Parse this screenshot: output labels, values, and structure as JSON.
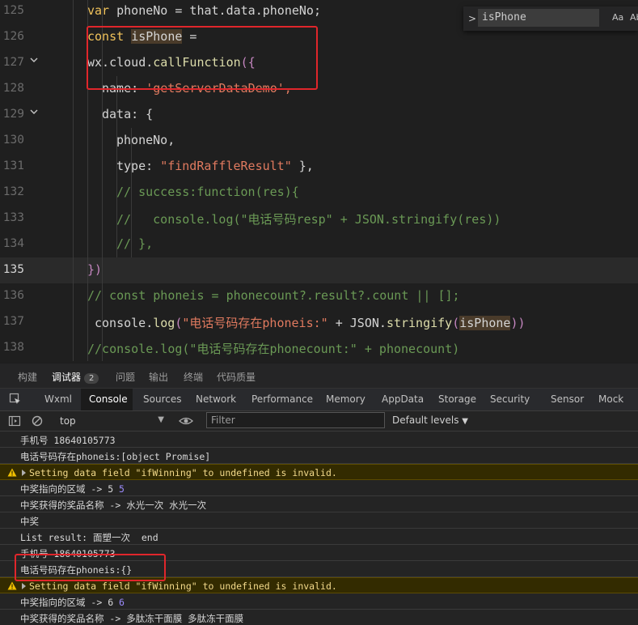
{
  "editor": {
    "lines": [
      {
        "no": "125",
        "segs": [
          {
            "t": "var ",
            "c": "kw"
          },
          {
            "t": "phoneNo = that.data.phoneNo;",
            "c": "var"
          }
        ]
      },
      {
        "no": "126",
        "segs": [
          {
            "t": "const ",
            "c": "kw"
          },
          {
            "t": "isPhone",
            "c": "var hl"
          },
          {
            "t": " =",
            "c": "var"
          }
        ]
      },
      {
        "no": "127",
        "segs": [
          {
            "t": "wx.cloud.",
            "c": "var"
          },
          {
            "t": "callFunction",
            "c": "fn"
          },
          {
            "t": "(",
            "c": "bracket"
          },
          {
            "t": "{",
            "c": "bracket"
          }
        ]
      },
      {
        "no": "128",
        "segs": [
          {
            "t": "name: ",
            "c": "prop"
          },
          {
            "t": "'getServerDataDemo',",
            "c": "str2"
          }
        ]
      },
      {
        "no": "129",
        "segs": [
          {
            "t": "data: {",
            "c": "prop"
          }
        ]
      },
      {
        "no": "130",
        "segs": [
          {
            "t": "phoneNo,",
            "c": "var"
          }
        ]
      },
      {
        "no": "131",
        "segs": [
          {
            "t": "type: ",
            "c": "prop"
          },
          {
            "t": "\"findRaffleResult\"",
            "c": "str2"
          },
          {
            "t": " },",
            "c": "var"
          }
        ]
      },
      {
        "no": "132",
        "segs": [
          {
            "t": "// success:function(res){",
            "c": "cm"
          }
        ]
      },
      {
        "no": "133",
        "segs": [
          {
            "t": "//   console.log(\"电话号码resp\" + JSON.stringify(res))",
            "c": "cm"
          }
        ]
      },
      {
        "no": "134",
        "segs": [
          {
            "t": "// },",
            "c": "cm"
          }
        ]
      },
      {
        "no": "135",
        "segs": [
          {
            "t": "}",
            "c": "bracket"
          },
          {
            "t": ")",
            "c": "bracket"
          }
        ]
      },
      {
        "no": "136",
        "segs": [
          {
            "t": "// const phoneis = phonecount?.result?.count || [];",
            "c": "cm"
          }
        ]
      },
      {
        "no": "137",
        "segs": [
          {
            "t": "console.",
            "c": "var"
          },
          {
            "t": "log",
            "c": "fn"
          },
          {
            "t": "(",
            "c": "bracket"
          },
          {
            "t": "\"电话号码存在phoneis:\"",
            "c": "str2"
          },
          {
            "t": " + JSON.",
            "c": "var"
          },
          {
            "t": "stringify",
            "c": "fn"
          },
          {
            "t": "(",
            "c": "bracket"
          },
          {
            "t": "isPhone",
            "c": "var hl"
          },
          {
            "t": "))",
            "c": "bracket"
          }
        ]
      },
      {
        "no": "138",
        "segs": [
          {
            "t": "//console.log(\"电话号码存在phonecount:\" + phonecount)",
            "c": "cm"
          }
        ]
      }
    ],
    "find_value": "isPhone",
    "find_opt_case": "Aa",
    "find_opt_word": "Ab"
  },
  "panel_tabs": {
    "build": "构建",
    "debugger": "调试器",
    "debugger_count": "2",
    "problems": "问题",
    "output": "输出",
    "terminal": "终端",
    "code_quality": "代码质量"
  },
  "devtools_tabs": [
    "Wxml",
    "Console",
    "Sources",
    "Network",
    "Performance",
    "Memory",
    "AppData",
    "Storage",
    "Security",
    "Sensor",
    "Mock"
  ],
  "toolbar": {
    "context": "top",
    "filter_placeholder": "Filter",
    "levels": "Default levels"
  },
  "console_rows": [
    {
      "type": "log",
      "text": "手机号 18640105773"
    },
    {
      "type": "log",
      "text": "电话号码存在phoneis:[object Promise]"
    },
    {
      "type": "warn",
      "text": "Setting data field \"ifWinning\" to undefined is invalid."
    },
    {
      "type": "log",
      "text": "中奖指向的区域 -> 5 ",
      "num": "5"
    },
    {
      "type": "log",
      "text": "中奖获得的奖品名称 -> 水光一次 水光一次"
    },
    {
      "type": "log",
      "text": "中奖"
    },
    {
      "type": "log",
      "text": "List result: 面塑一次  end"
    },
    {
      "type": "log",
      "text": "手机号 18640105773"
    },
    {
      "type": "log",
      "text": "电话号码存在phoneis:{}"
    },
    {
      "type": "warn",
      "text": "Setting data field \"ifWinning\" to undefined is invalid."
    },
    {
      "type": "log",
      "text": "中奖指向的区域 -> 6 ",
      "num": "6"
    },
    {
      "type": "log",
      "text": "中奖获得的奖品名称 -> 多肽冻干面膜 多肽冻干面膜"
    }
  ],
  "colors": {
    "highlight_box": "#e0262b",
    "warning_bg": "#332b00",
    "keyword": "#f1c35b"
  }
}
